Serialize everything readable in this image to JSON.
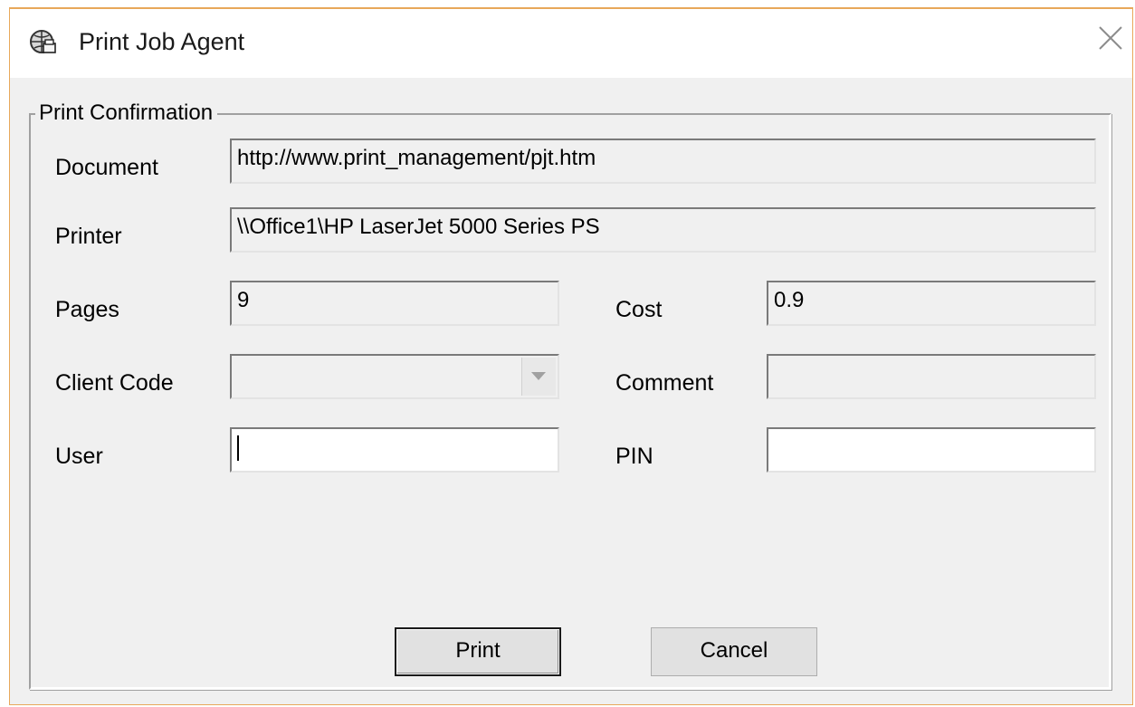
{
  "window": {
    "title": "Print Job Agent",
    "icon": "globe-printer-icon",
    "accent_border": "#e8a85a"
  },
  "group": {
    "legend": "Print Confirmation"
  },
  "fields": {
    "document": {
      "label": "Document",
      "value": "http://www.print_management/pjt.htm"
    },
    "printer": {
      "label": "Printer",
      "value": "\\\\Office1\\HP LaserJet 5000 Series PS"
    },
    "pages": {
      "label": "Pages",
      "value": "9"
    },
    "cost": {
      "label": "Cost",
      "value": "0.9"
    },
    "client_code": {
      "label": "Client Code",
      "value": ""
    },
    "comment": {
      "label": "Comment",
      "value": ""
    },
    "user": {
      "label": "User",
      "value": ""
    },
    "pin": {
      "label": "PIN",
      "value": ""
    }
  },
  "buttons": {
    "print": "Print",
    "cancel": "Cancel"
  }
}
